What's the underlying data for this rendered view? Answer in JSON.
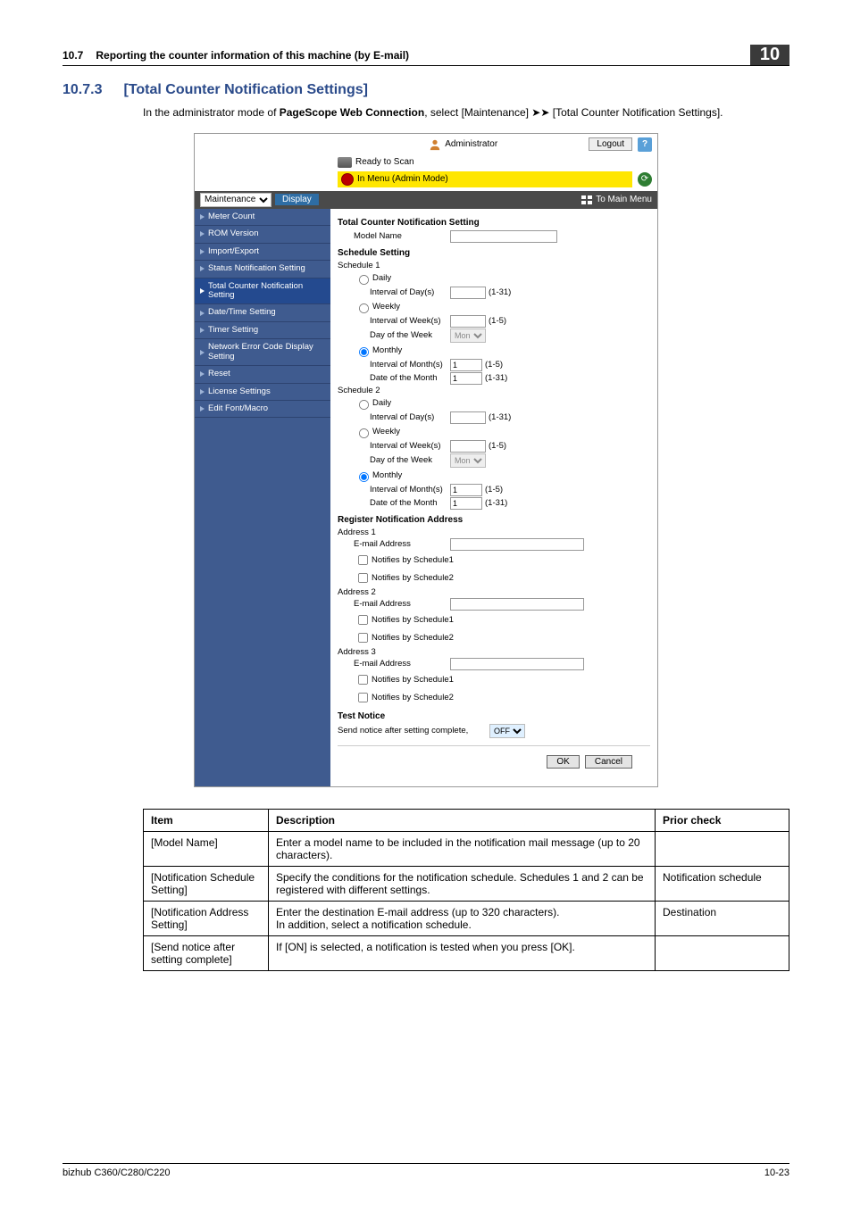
{
  "header": {
    "secno": "10.7",
    "sectitle": "Reporting the counter information of this machine (by E-mail)",
    "badge": "10"
  },
  "heading": {
    "num": "10.7.3",
    "title": "[Total Counter Notification Settings]"
  },
  "intro": {
    "pre": "In the administrator mode of ",
    "bold": "PageScope Web Connection",
    "mid": ", select [Maintenance] ",
    "arrows": "➤➤",
    "post": " [Total Counter Notification Settings]."
  },
  "ui": {
    "admin": "Administrator",
    "ready": "Ready to Scan",
    "inmenu": "In Menu (Admin Mode)",
    "logout": "Logout",
    "help": "?",
    "maint_select": "Maintenance",
    "display": "Display",
    "to_main": "To Main Menu",
    "sidebar": [
      "Meter Count",
      "ROM Version",
      "Import/Export",
      "Status Notification Setting",
      "Total Counter Notification Setting",
      "Date/Time Setting",
      "Timer Setting",
      "Network Error Code Display Setting",
      "Reset",
      "License Settings",
      "Edit Font/Macro"
    ],
    "content": {
      "title1": "Total Counter Notification Setting",
      "model_name": "Model Name",
      "title2": "Schedule Setting",
      "sched1": "Schedule 1",
      "sched2": "Schedule 2",
      "daily": "Daily",
      "weekly": "Weekly",
      "monthly": "Monthly",
      "int_day": "Interval of Day(s)",
      "int_week": "Interval of Week(s)",
      "day_of_week": "Day of the Week",
      "int_month": "Interval of Month(s)",
      "date_of_month": "Date of the Month",
      "range_1_31": "(1-31)",
      "range_1_5": "(1-5)",
      "mon": "Mon",
      "one": "1",
      "title3": "Register Notification Address",
      "addr1": "Address 1",
      "addr2": "Address 2",
      "addr3": "Address 3",
      "email": "E-mail Address",
      "notif1": "Notifies by Schedule1",
      "notif2": "Notifies by Schedule2",
      "title4": "Test Notice",
      "send_notice": "Send notice after setting complete,",
      "off": "OFF",
      "ok": "OK",
      "cancel": "Cancel"
    }
  },
  "table": {
    "h1": "Item",
    "h2": "Description",
    "h3": "Prior check",
    "r1c1": "[Model Name]",
    "r1c2": "Enter a model name to be included in the notification mail message (up to 20 characters).",
    "r1c3": "",
    "r2c1": "[Notification Schedule Setting]",
    "r2c2": "Specify the conditions for the notification schedule. Schedules 1 and 2 can be registered with different settings.",
    "r2c3": "Notification schedule",
    "r3c1": "[Notification Address Setting]",
    "r3c2": "Enter the destination E-mail address (up to 320 characters).\nIn addition, select a notification schedule.",
    "r3c3": "Destination",
    "r4c1": "[Send notice after setting complete]",
    "r4c2": "If [ON] is selected, a notification is tested when you press [OK].",
    "r4c3": ""
  },
  "footer": {
    "left": "bizhub C360/C280/C220",
    "right": "10-23"
  }
}
